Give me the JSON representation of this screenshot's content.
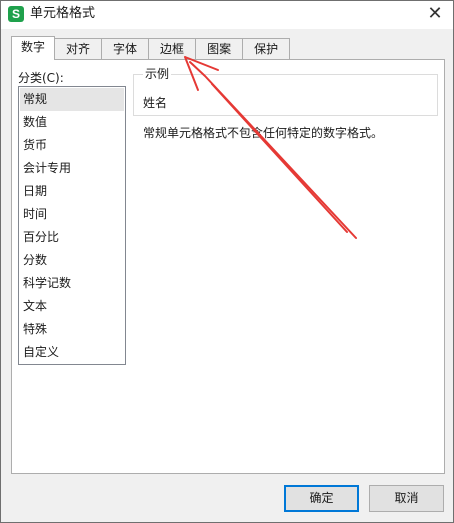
{
  "window": {
    "title": "单元格格式",
    "close_glyph": "✕",
    "icon": "wps-spreadsheet-icon",
    "icon_glyph": "S"
  },
  "tabs": [
    {
      "label": "数字",
      "active": true
    },
    {
      "label": "对齐",
      "active": false
    },
    {
      "label": "字体",
      "active": false
    },
    {
      "label": "边框",
      "active": false
    },
    {
      "label": "图案",
      "active": false
    },
    {
      "label": "保护",
      "active": false
    }
  ],
  "category": {
    "label": "分类(C):",
    "items": [
      "常规",
      "数值",
      "货币",
      "会计专用",
      "日期",
      "时间",
      "百分比",
      "分数",
      "科学记数",
      "文本",
      "特殊",
      "自定义"
    ],
    "selected_index": 0
  },
  "sample": {
    "legend": "示例",
    "value": "姓名"
  },
  "description": "常规单元格格式不包含任何特定的数字格式。",
  "buttons": {
    "ok": "确定",
    "cancel": "取消"
  },
  "annotation": {
    "color": "#e53935",
    "target": "tab-border"
  }
}
